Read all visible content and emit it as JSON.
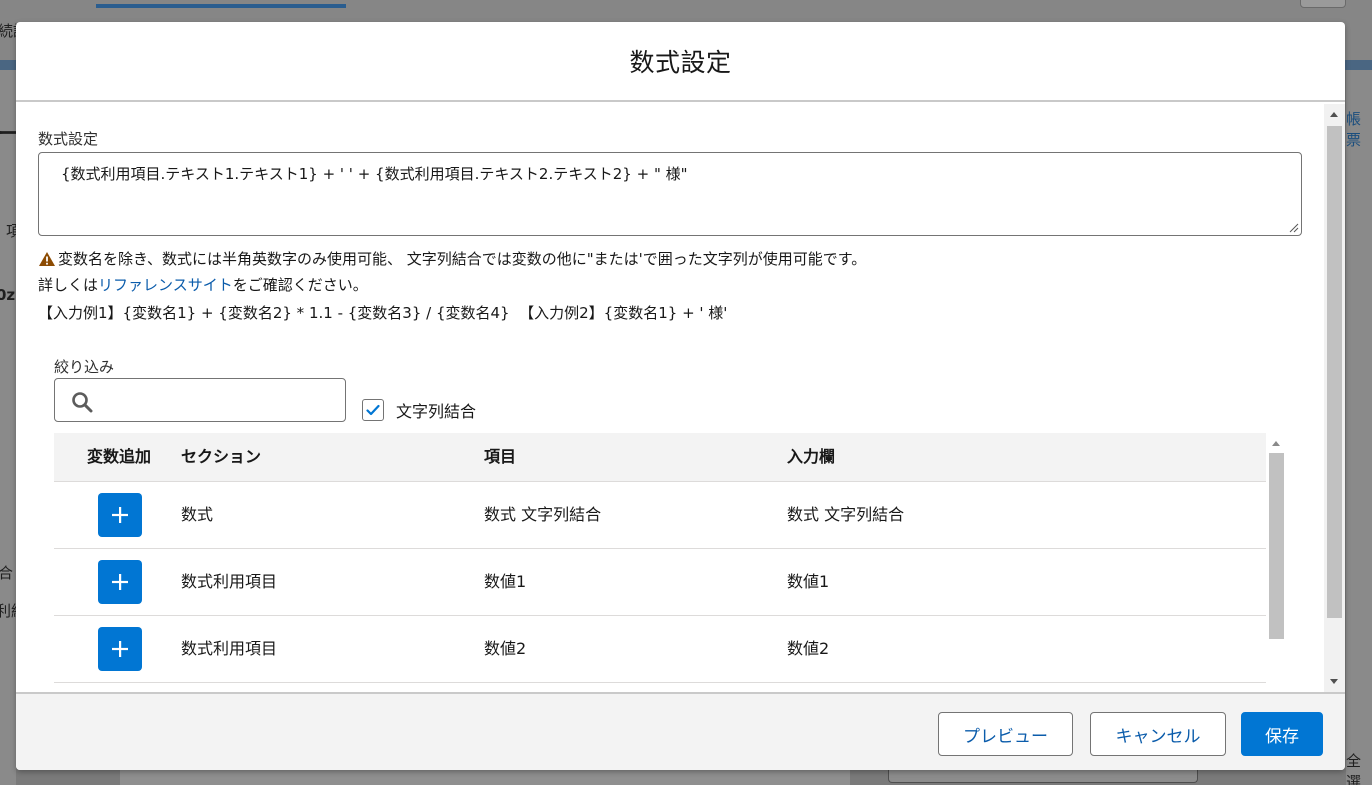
{
  "background": {
    "left_texts": [
      "続調",
      "ー",
      "項",
      "0z",
      "合",
      "利結"
    ],
    "right_texts": [
      "帳票",
      "全選"
    ]
  },
  "modal": {
    "title": "数式設定",
    "formula_label": "数式設定",
    "formula_value": "{数式利用項目.テキスト1.テキスト1}  + ' ' + {数式利用項目.テキスト2.テキスト2} + \" 様\"",
    "warning_text": "変数名を除き、数式には半角英数字のみ使用可能、 文字列結合では変数の他に\"または'で囲った文字列が使用可能です。",
    "help_prefix": "詳しくは",
    "help_link": "リファレンスサイト",
    "help_suffix": "をご確認ください。",
    "example_text": "【入力例1】{変数名1} + {変数名2} * 1.1 - {変数名3} / {変数名4}  【入力例2】{変数名1} + ' 様'",
    "filter_label": "絞り込み",
    "search_placeholder": "",
    "checkbox_label": "文字列結合",
    "checkbox_checked": true
  },
  "table": {
    "headers": [
      "変数追加",
      "セクション",
      "項目",
      "入力欄"
    ],
    "rows": [
      {
        "section": "数式",
        "item": "数式 文字列結合",
        "input": "数式 文字列結合"
      },
      {
        "section": "数式利用項目",
        "item": "数値1",
        "input": "数値1"
      },
      {
        "section": "数式利用項目",
        "item": "数値2",
        "input": "数値2"
      }
    ]
  },
  "footer": {
    "preview_label": "プレビュー",
    "cancel_label": "キャンセル",
    "save_label": "保存"
  },
  "colors": {
    "brand": "#0176d3",
    "link": "#0b5cab",
    "warning": "#8c4b02"
  },
  "icons": {
    "warning": "warning-icon",
    "search": "search-icon",
    "check": "check-icon",
    "add": "add-icon"
  }
}
